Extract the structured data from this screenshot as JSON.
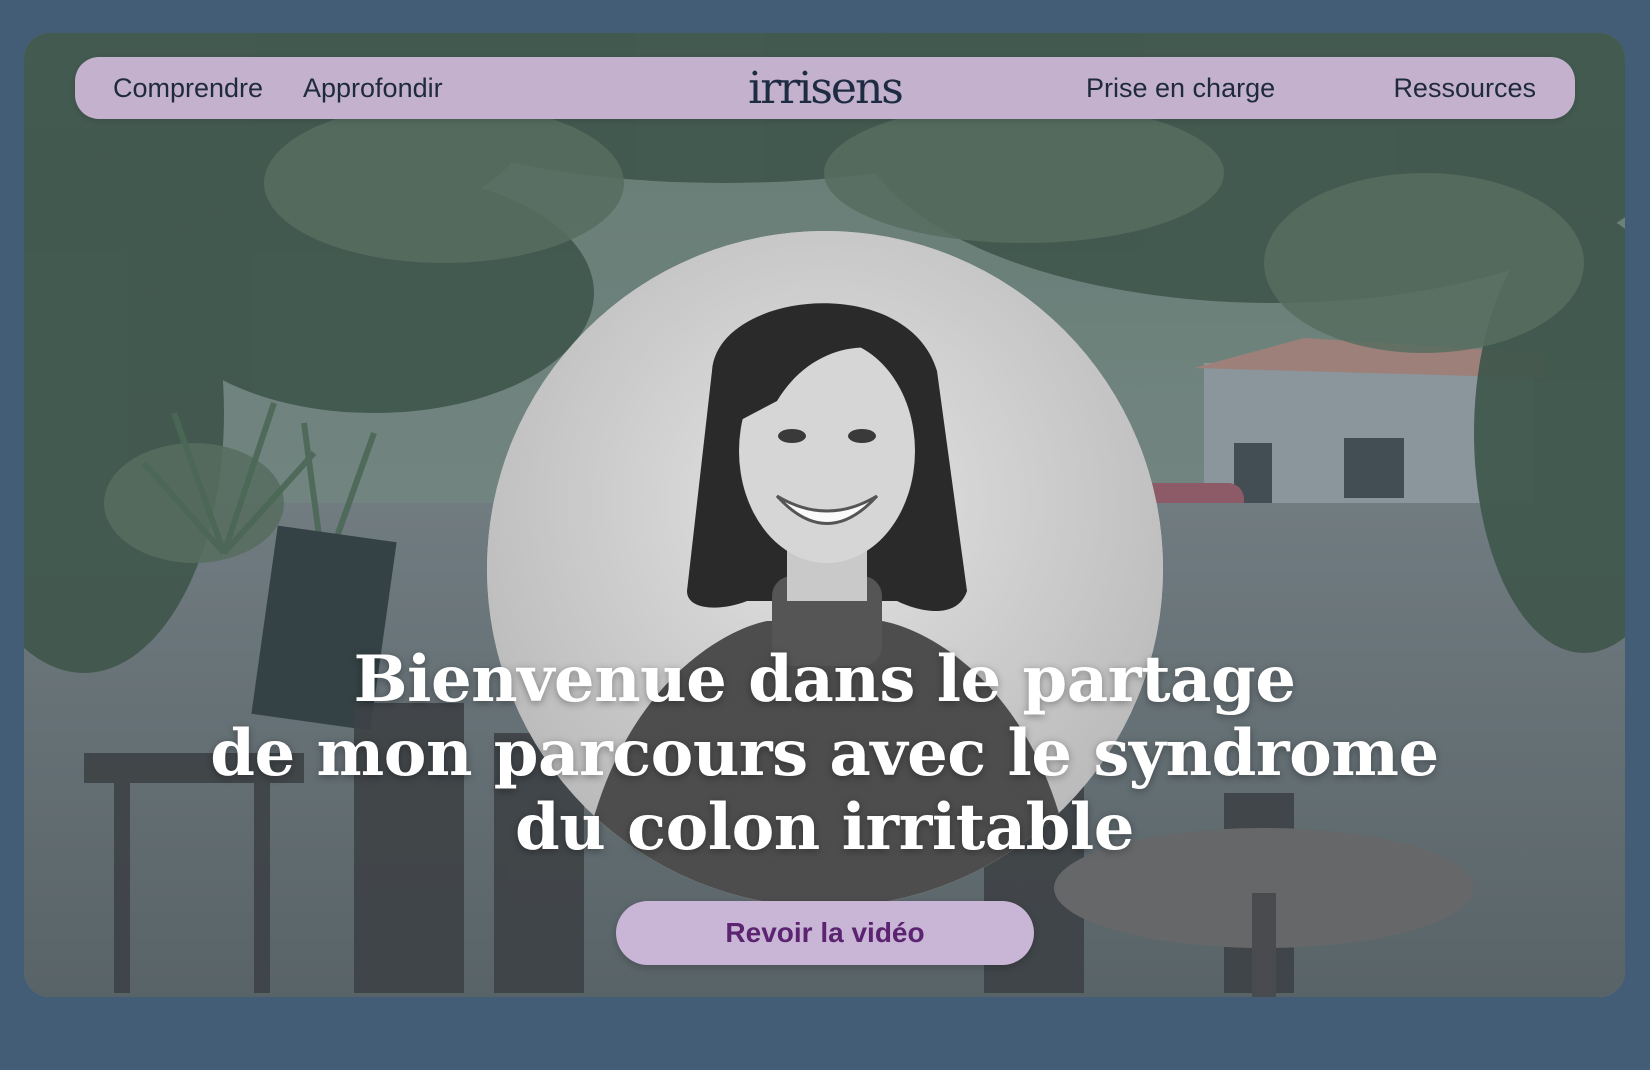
{
  "nav": {
    "left_links": [
      "Comprendre",
      "Approfondir"
    ],
    "logo_text": "irrisens",
    "right_links": [
      "Prise en charge",
      "Ressources"
    ]
  },
  "hero": {
    "headline_lines": [
      "Bienvenue dans le partage",
      "de mon parcours avec le syndrome",
      "du colon irritable"
    ],
    "cta_label": "Revoir la vidéo",
    "background_image": "outdoor-cafe-terrace-photo",
    "portrait_image": "smiling-woman-black-and-white-portrait"
  },
  "colors": {
    "page_background": "#445d76",
    "nav_background": "#c3b1cd",
    "nav_text": "#1f2b3b",
    "logo_text": "#1e2c43",
    "headline_text": "#ffffff",
    "cta_background": "#c9b6d6",
    "cta_text": "#5c2470"
  }
}
